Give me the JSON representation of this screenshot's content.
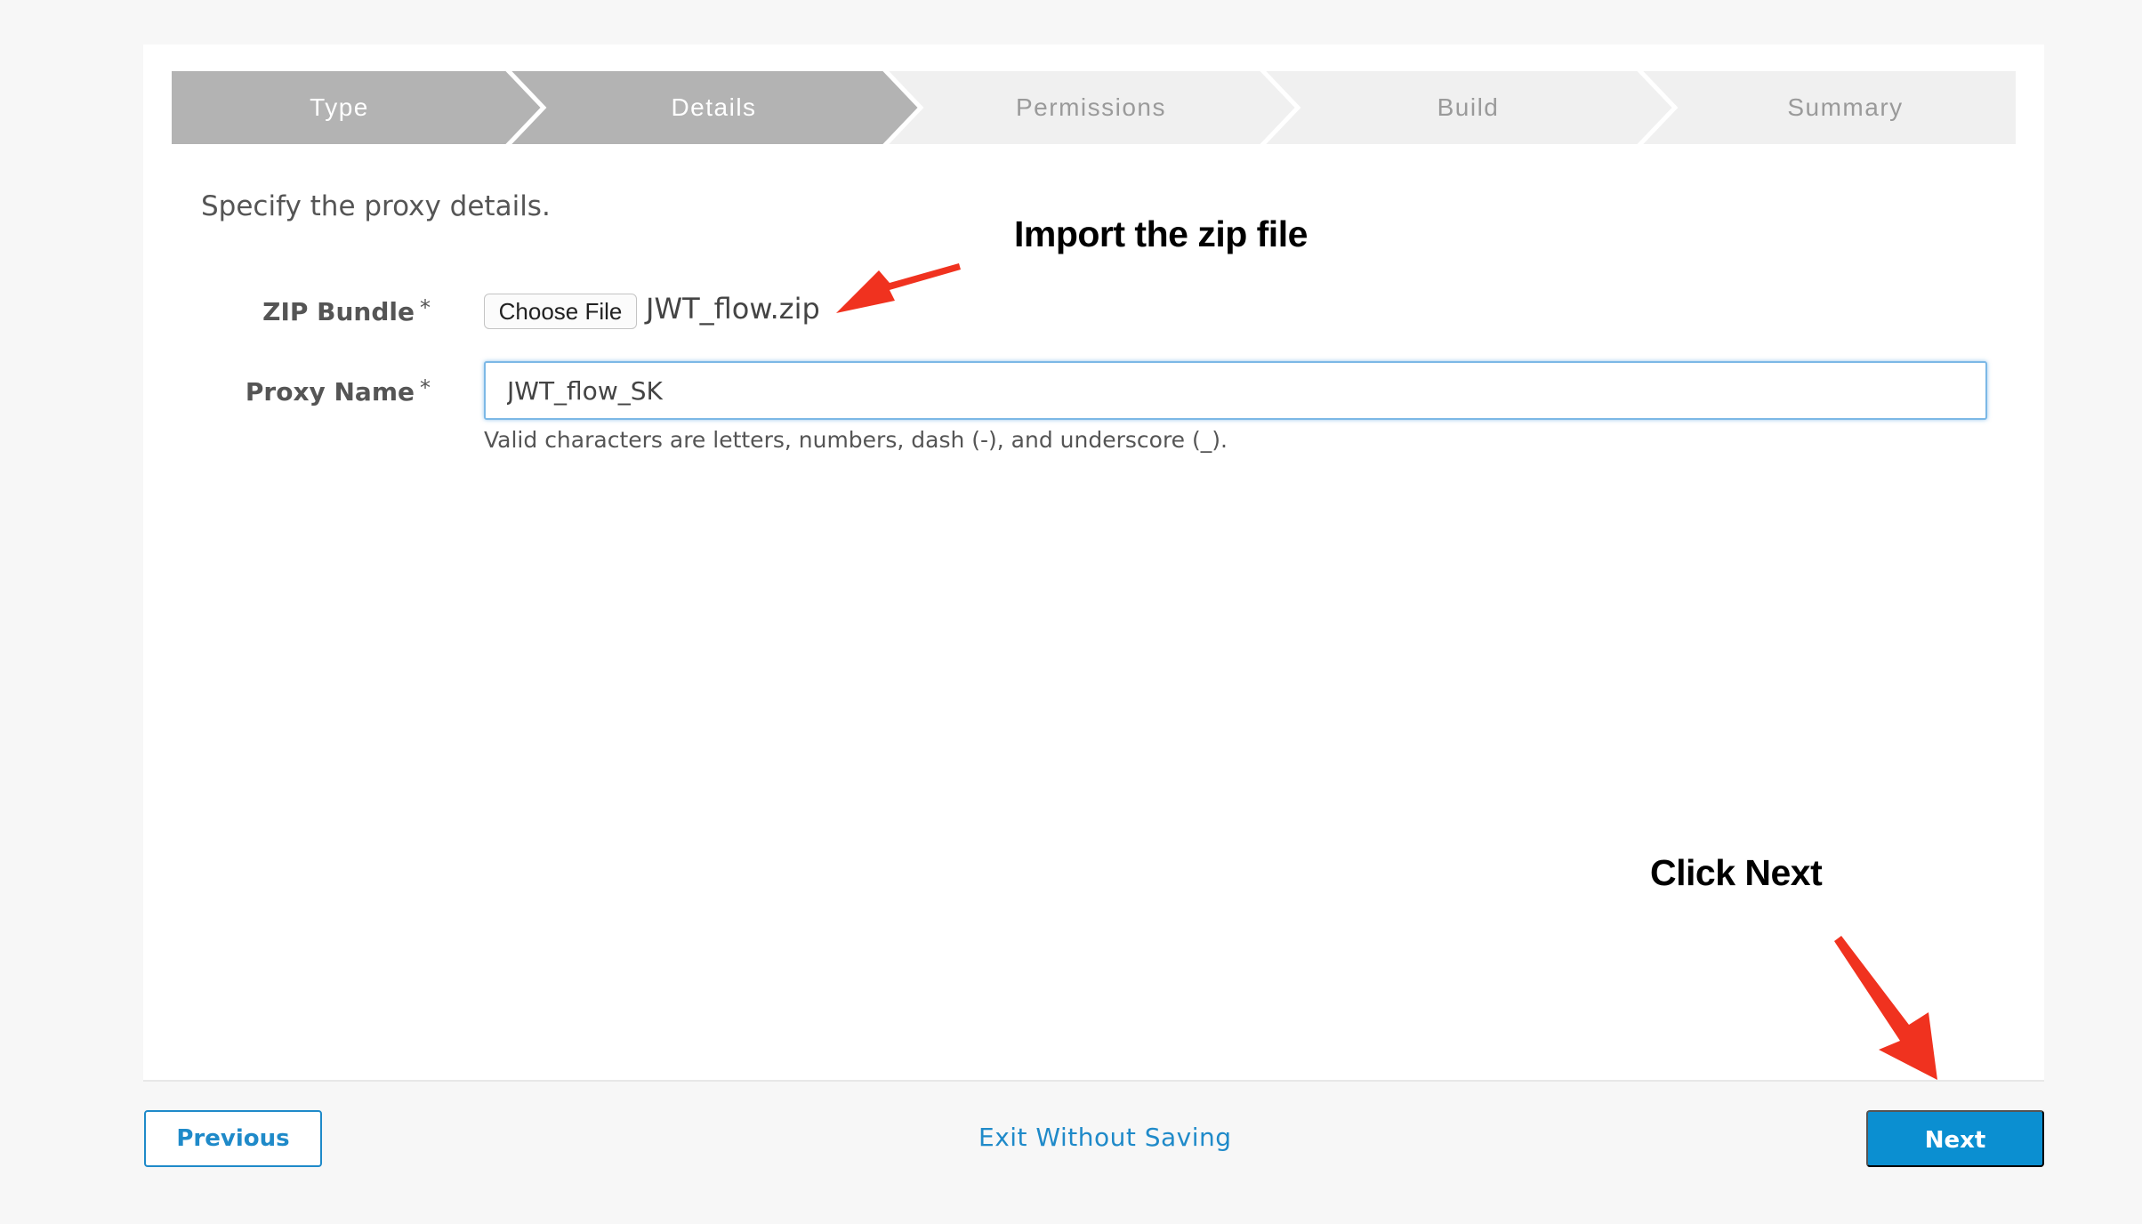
{
  "wizard": {
    "steps": [
      {
        "label": "Type",
        "state": "done"
      },
      {
        "label": "Details",
        "state": "active"
      },
      {
        "label": "Permissions",
        "state": "todo"
      },
      {
        "label": "Build",
        "state": "todo"
      },
      {
        "label": "Summary",
        "state": "todo"
      }
    ],
    "colors": {
      "done": "#b3b3b3",
      "todo": "#f0f0f0",
      "separator": "#ffffff",
      "accent": "#0b8fd1"
    }
  },
  "form": {
    "instructions": "Specify the proxy details.",
    "zip_bundle": {
      "label": "ZIP Bundle",
      "required_mark": "*",
      "button_label": "Choose File",
      "file_name": "JWT_flow.zip"
    },
    "proxy_name": {
      "label": "Proxy Name",
      "required_mark": "*",
      "value": "JWT_flow_SK",
      "hint": "Valid characters are letters, numbers, dash (-), and underscore (_)."
    }
  },
  "annotations": {
    "import_zip": "Import the zip file",
    "click_next": "Click Next",
    "arrow_color": "#f0321f"
  },
  "footer": {
    "previous_label": "Previous",
    "exit_label": "Exit Without Saving",
    "next_label": "Next"
  }
}
